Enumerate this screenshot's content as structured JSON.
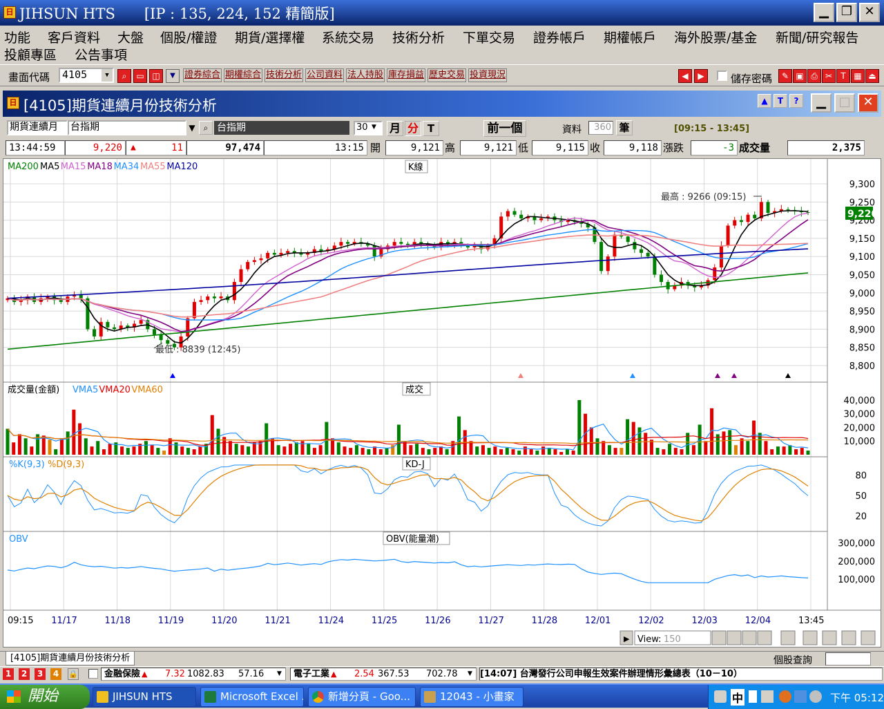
{
  "window": {
    "app_icon": "JIHSUN-logo-icon",
    "title": "JIHSUN HTS　　[IP : 135, 224, 152 精簡版]"
  },
  "menu": {
    "row1": [
      "功能",
      "客戶資料",
      "大盤",
      "個股/權證",
      "期貨/選擇權",
      "系統交易",
      "技術分析",
      "下單交易",
      "證券帳戶",
      "期權帳戶",
      "海外股票/基金",
      "新聞/研究報告"
    ],
    "row2": [
      "投顧專區",
      "公告事項"
    ]
  },
  "toolbar": {
    "code_label": "畫面代碼",
    "code_value": "4105",
    "quick": [
      "證券綜合",
      "期權綜合",
      "技術分析",
      "公司資料",
      "法人持股",
      "庫存損益",
      "歷史交易",
      "投資現況"
    ],
    "save_password": "儲存密碼"
  },
  "child": {
    "title": "[4105]期貨連續月份技術分析",
    "btns": [
      "▲",
      "T",
      "?"
    ]
  },
  "info": {
    "product_type": "期貨連續月",
    "symbol": "台指期",
    "symbol_name": "台指期",
    "period": "30",
    "btn_month": "月",
    "btn_min": "分",
    "btn_tick": "T",
    "prev": "前一個",
    "data_label": "資料",
    "data_count": "360",
    "count_unit": "筆",
    "session": "[09:15 - 13:45]"
  },
  "quote": {
    "time": "13:44:59",
    "price": "9,220",
    "change": "11",
    "volume_total": "97,474",
    "bar_time": "13:15",
    "open_label": "開",
    "open": "9,121",
    "high_label": "高",
    "high": "9,121",
    "low_label": "低",
    "low": "9,115",
    "close_label": "收",
    "close": "9,118",
    "chg_label": "漲跌",
    "chg": "-3",
    "vol_label": "成交量",
    "vol": "2,375"
  },
  "chart_data": [
    {
      "type": "line",
      "title": "K線",
      "legend": [
        "MA200",
        "MA5",
        "MA15",
        "MA18",
        "MA34",
        "MA55",
        "MA120"
      ],
      "legend_colors": [
        "#008000",
        "#000000",
        "#d060d0",
        "#800080",
        "#1e90ff",
        "#f08080",
        "#0000a0"
      ],
      "ylim": [
        8760,
        9340
      ],
      "yticks": [
        "9,300",
        "9,250",
        "9,200",
        "9,150",
        "9,100",
        "9,050",
        "9,000",
        "8,950",
        "8,900",
        "8,850",
        "8,800"
      ],
      "last_price": "9,220",
      "annotations": {
        "high": "最高 : 9266 (09:15)",
        "low": "最低 : 8839 (12:45)"
      },
      "x": [
        "09:15",
        "11/17",
        "11/18",
        "11/19",
        "11/20",
        "11/21",
        "11/24",
        "11/25",
        "11/26",
        "11/27",
        "11/28",
        "12/01",
        "12/02",
        "12/03",
        "12/04",
        "13:45"
      ],
      "closes": [
        8985,
        8975,
        8980,
        8990,
        8975,
        8985,
        8990,
        8980,
        8975,
        8990,
        8995,
        8985,
        8900,
        8880,
        8920,
        8905,
        8900,
        8910,
        8905,
        8915,
        8925,
        8900,
        8885,
        8870,
        8860,
        8850,
        8880,
        8930,
        8975,
        8980,
        8990,
        8985,
        8990,
        8980,
        9030,
        9065,
        9085,
        9090,
        9095,
        9110,
        9105,
        9110,
        9115,
        9110,
        9105,
        9110,
        9120,
        9115,
        9120,
        9130,
        9140,
        9135,
        9140,
        9135,
        9130,
        9100,
        9120,
        9130,
        9140,
        9135,
        9130,
        9140,
        9135,
        9130,
        9125,
        9140,
        9135,
        9140,
        9130,
        9125,
        9130,
        9120,
        9130,
        9150,
        9210,
        9225,
        9215,
        9205,
        9210,
        9200,
        9205,
        9210,
        9200,
        9195,
        9200,
        9195,
        9190,
        9180,
        9140,
        9060,
        9100,
        9160,
        9155,
        9140,
        9120,
        9110,
        9100,
        9050,
        9030,
        9010,
        9020,
        9030,
        9020,
        9015,
        9020,
        9035,
        9070,
        9130,
        9185,
        9200,
        9195,
        9215,
        9205,
        9250,
        9220,
        9225,
        9230,
        9228,
        9225,
        9222,
        9220
      ],
      "ma": {
        "MA5": [
          8985,
          8983,
          8980,
          8985,
          8982,
          8980,
          8984,
          8986,
          8983,
          8982,
          8984,
          8983,
          8960,
          8930,
          8910,
          8900,
          8895,
          8900,
          8905,
          8906,
          8910,
          8912,
          8905,
          8895,
          8880,
          8865,
          8862,
          8875,
          8895,
          8920,
          8945,
          8965,
          8980,
          8985,
          8995,
          9010,
          9030,
          9055,
          9075,
          9090,
          9100,
          9103,
          9108,
          9110,
          9110,
          9110,
          9112,
          9114,
          9116,
          9120,
          9125,
          9130,
          9135,
          9137,
          9136,
          9130,
          9125,
          9123,
          9125,
          9128,
          9130,
          9133,
          9135,
          9135,
          9133,
          9135,
          9135,
          9136,
          9134,
          9132,
          9130,
          9128,
          9127,
          9133,
          9155,
          9175,
          9190,
          9200,
          9210,
          9210,
          9208,
          9206,
          9205,
          9203,
          9201,
          9198,
          9195,
          9190,
          9180,
          9150,
          9130,
          9125,
          9125,
          9130,
          9135,
          9130,
          9118,
          9100,
          9075,
          9050,
          9035,
          9025,
          9022,
          9020,
          9020,
          9022,
          9030,
          9050,
          9085,
          9125,
          9160,
          9185,
          9200,
          9210,
          9215,
          9220,
          9225,
          9226,
          9226,
          9225,
          9224
        ]
      },
      "volume_title": "成交量(金額)",
      "volume_legend": [
        "VMA5",
        "VMA20",
        "VMA60"
      ],
      "volume_legend_colors": [
        "#1e90ff",
        "#e00000",
        "#e08000"
      ],
      "volume_yticks": [
        "40,000",
        "30,000",
        "20,000",
        "10,000"
      ],
      "volume_label": "成交",
      "volumes": [
        19000,
        9000,
        15000,
        12000,
        6000,
        15000,
        14000,
        11000,
        4000,
        12000,
        17000,
        33000,
        23000,
        12000,
        6000,
        10000,
        4000,
        8000,
        9000,
        6000,
        5000,
        6000,
        8000,
        10000,
        7000,
        5000,
        3000,
        12000,
        9000,
        6000,
        5000,
        4000,
        6000,
        8000,
        29000,
        19000,
        13000,
        10000,
        8000,
        7000,
        6000,
        9000,
        10000,
        23000,
        12000,
        7000,
        6000,
        8000,
        9000,
        10000,
        8000,
        5000,
        7000,
        24000,
        12000,
        9000,
        6000,
        5000,
        7000,
        5000,
        4000,
        6000,
        4000,
        5000,
        7000,
        22000,
        10000,
        7000,
        8000,
        5000,
        4000,
        5000,
        6000,
        4000,
        10000,
        28000,
        18000,
        10000,
        6000,
        7000,
        5000,
        6000,
        4000,
        5000,
        4000,
        3000,
        6000,
        4000,
        3000,
        6000,
        5000,
        4000,
        2000,
        4000,
        3000,
        40000,
        30000,
        20000,
        12000,
        10000,
        7000,
        5000,
        5000,
        26000,
        24000,
        20000,
        16000,
        11000,
        5000,
        4000,
        8000,
        5000,
        4000,
        16000,
        7000,
        22000,
        10000,
        34000,
        15000,
        17000,
        18000,
        7000,
        12000,
        10000,
        25000,
        16000,
        10000,
        4000,
        6000,
        6000,
        7000,
        4000,
        5000,
        3000
      ],
      "kd_title": "%K(9,3)",
      "kd_title2": "%D(9,3)",
      "kd_label": "KD-J",
      "kd_yticks": [
        "80",
        "50",
        "20"
      ],
      "obv_title": "OBV",
      "obv_label": "OBV(能量潮)",
      "obv_yticks": [
        "300,000",
        "200,000",
        "100,000"
      ]
    }
  ],
  "chart_footer": {
    "view_label": "View:",
    "view_value": "150"
  },
  "tab": {
    "label": "[4105]期貨連續月份技術分析",
    "stock_query": "個股查詢"
  },
  "ticker": {
    "pages": [
      "1",
      "2",
      "3",
      "4"
    ],
    "item1_name": "金融保險",
    "item1_chg": "7.32",
    "item1_val": "1082.83",
    "item1_vol": "57.16",
    "item2_name": "電子工業",
    "item2_chg": "2.54",
    "item2_val": "367.53",
    "item2_vol": "702.78",
    "news": "[14:07]  台灣發行公司申報生效案件辦理情形彙總表（10－10）"
  },
  "taskbar": {
    "start": "開始",
    "tasks": [
      "JIHSUN HTS",
      "Microsoft Excel ...",
      "新增分頁 - Goo...",
      "12043 - 小畫家"
    ],
    "ime": "中",
    "clock": "下午 05:12"
  }
}
